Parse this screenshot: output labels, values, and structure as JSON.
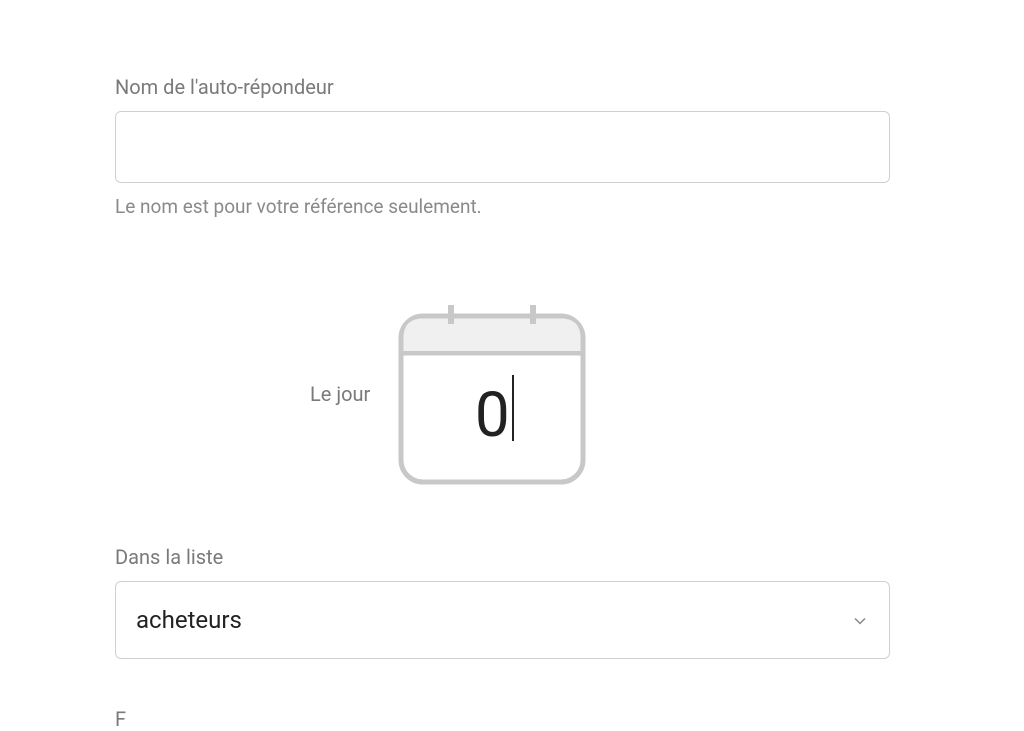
{
  "autoresponder": {
    "name_label": "Nom de l'auto-répondeur",
    "name_value": "",
    "name_helper": "Le nom est pour votre référence seulement."
  },
  "day": {
    "label": "Le jour",
    "value": "0"
  },
  "list": {
    "label": "Dans la liste",
    "selected": "acheteurs"
  },
  "partial": {
    "text": "F"
  },
  "colors": {
    "border": "#d0d0d0",
    "label": "#7a7a7a",
    "text": "#222"
  }
}
